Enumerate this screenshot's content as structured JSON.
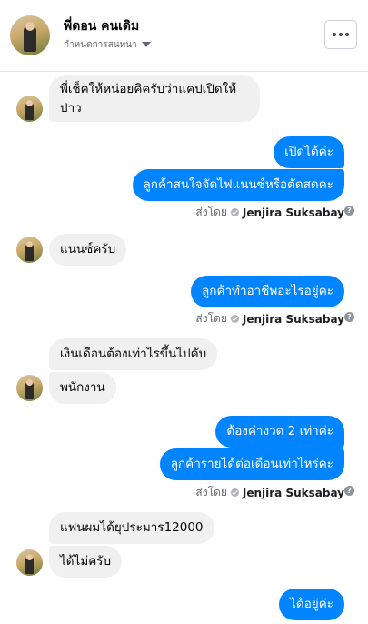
{
  "header": {
    "name": "พี่ดอน คนเดิม",
    "subtitle": "กำหนดการสนทนา",
    "more_icon": "more-dots-icon"
  },
  "messages": [
    {
      "side": "in",
      "text1": "พี่เช็คให้หน่อยคิครับว่าแคปเปิดให้",
      "text2": "ป่าว"
    },
    {
      "side": "out",
      "text": "เปิดได้ค่ะ"
    },
    {
      "side": "out",
      "text": "ลูกค้าสนใจจัดไฟแนนซ์หรือตัดสดคะ"
    },
    {
      "side": "in",
      "text": "แนนซ์ครับ"
    },
    {
      "side": "out",
      "text": "ลูกค้าทำอาชีพอะไรอยู่คะ"
    },
    {
      "side": "in",
      "text": "เงินเดือนต้องเท่าไรขึ้นไปคับ"
    },
    {
      "side": "in",
      "text": "พนักงาน"
    },
    {
      "side": "out",
      "text": "ต้องค่างวด 2 เท่าค่ะ"
    },
    {
      "side": "out",
      "text": "ลูกค้ารายได้ต่อเดือนเท่าไหร่คะ"
    },
    {
      "side": "in",
      "text": "แฟนผมได้ยุประมาร12000"
    },
    {
      "side": "in",
      "text": "ได้ไม่ครับ"
    },
    {
      "side": "out",
      "text": "ได้อยู่ค่ะ"
    }
  ],
  "sent_by": {
    "label": "ส่งโดย",
    "name": "Jenjira Suksabay",
    "info_icon": "?"
  }
}
